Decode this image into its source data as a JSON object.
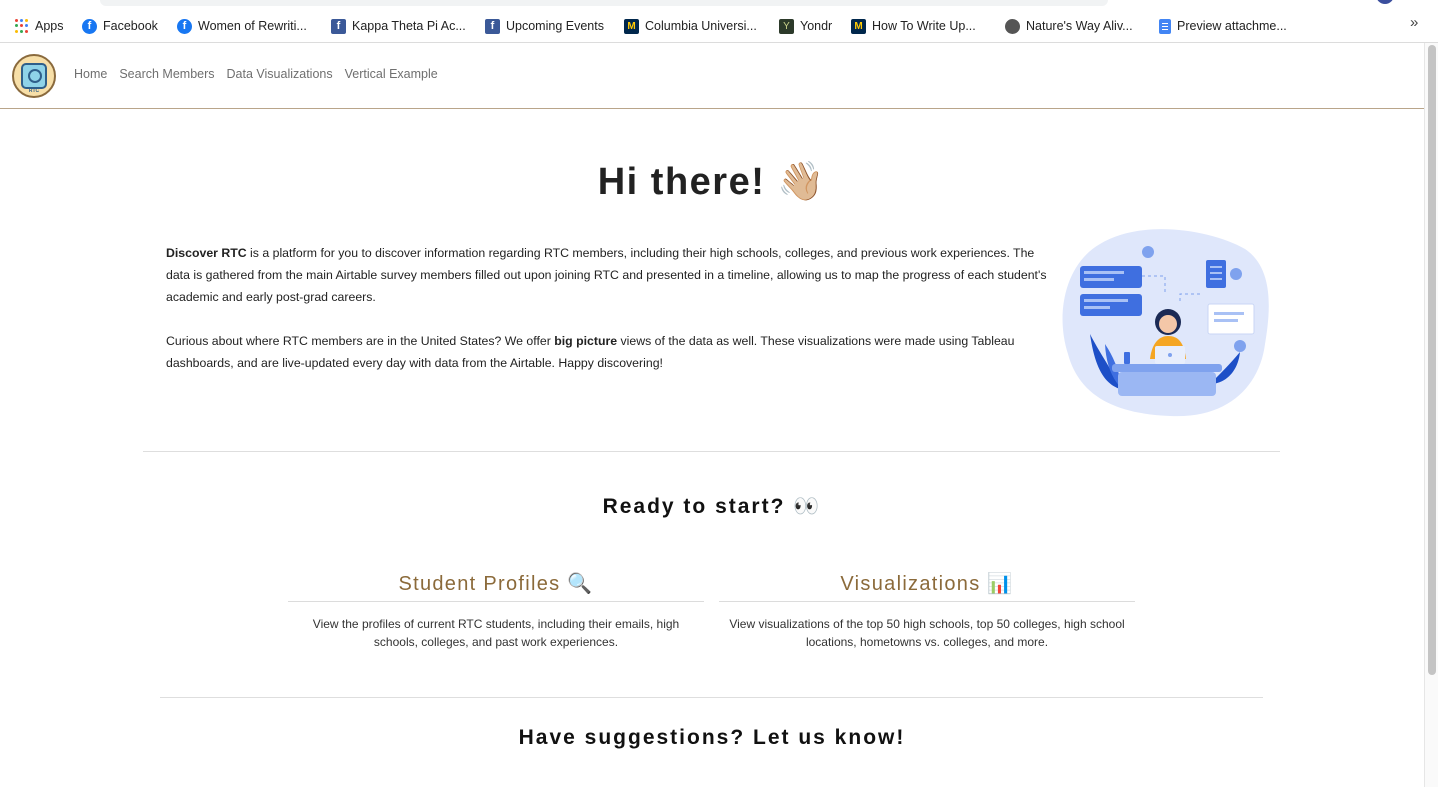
{
  "bookmarks": {
    "apps": "Apps",
    "items": [
      {
        "label": "Facebook"
      },
      {
        "label": "Women of Rewriti..."
      },
      {
        "label": "Kappa Theta Pi Ac..."
      },
      {
        "label": "Upcoming Events"
      },
      {
        "label": "Columbia Universi..."
      },
      {
        "label": "Yondr"
      },
      {
        "label": "How To Write Up..."
      },
      {
        "label": "Nature's Way Aliv..."
      },
      {
        "label": "Preview attachme..."
      }
    ],
    "more": "»"
  },
  "navbar": {
    "logo_text": "RTC",
    "links": [
      "Home",
      "Search Members",
      "Data Visualizations",
      "Vertical Example"
    ]
  },
  "hero": {
    "title": "Hi there! 👋🏼",
    "intro": {
      "p1_bold": "Discover RTC",
      "p1_rest": " is a platform for you to discover information regarding RTC members, including their high schools, colleges, and previous work experiences. The data is gathered from the main Airtable survey members filled out upon joining RTC and presented in a timeline, allowing us to map the progress of each student's academic and early post-grad careers.",
      "p2_start": "Curious about where RTC members are in the United States? We offer ",
      "p2_bold": "big picture",
      "p2_rest": " views of the data as well. These visualizations were made using Tableau dashboards, and are live-updated every day with data from the Airtable. Happy discovering!"
    }
  },
  "start": {
    "title": "Ready to start? 👀",
    "cards": [
      {
        "title": "Student Profiles 🔍",
        "desc": "View the profiles of current RTC students, including their emails, high schools, colleges, and past work experiences."
      },
      {
        "title": "Visualizations 📊",
        "desc": "View visualizations of the top 50 high schools, top 50 colleges, high school locations, hometowns vs. colleges, and more."
      }
    ]
  },
  "suggestions": {
    "title": "Have suggestions? Let us know!"
  },
  "colors": {
    "accent_brown": "#8b6a3a",
    "nav_border": "#b9a58a",
    "illustration_blue": "#3f6fe0"
  }
}
